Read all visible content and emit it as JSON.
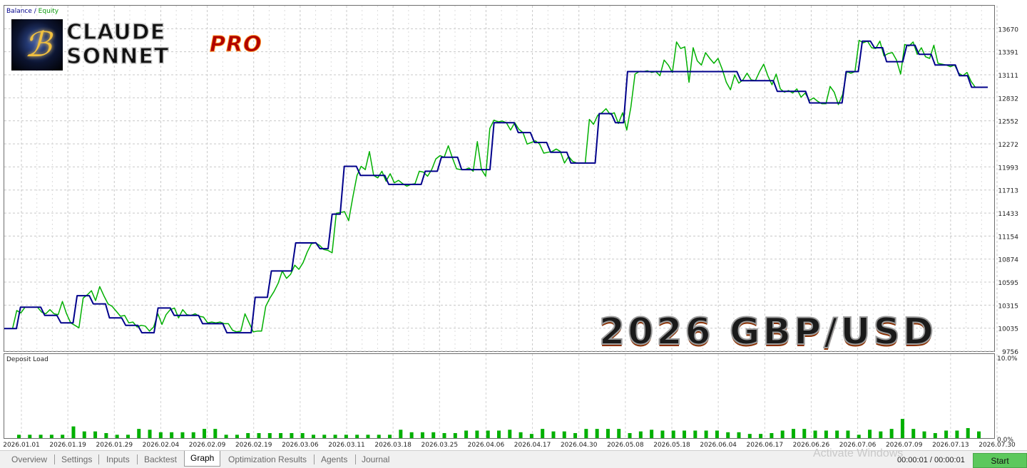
{
  "chart_data": [
    {
      "type": "line",
      "legend": [
        "Balance",
        "Equity"
      ],
      "legend_placement": "top-left",
      "colors": {
        "balance": "#00008b",
        "equity": "#00b000"
      },
      "grid": true,
      "ylim": [
        9756,
        13950
      ],
      "y_ticks": [
        "13670",
        "13391",
        "13111",
        "12832",
        "12552",
        "12272",
        "11993",
        "11713",
        "11433",
        "11154",
        "10874",
        "10595",
        "10315",
        "10035",
        "9756"
      ],
      "x_ticks": [
        "2026.01.01",
        "2026.01.19",
        "2026.01.29",
        "2026.02.04",
        "2026.02.09",
        "2026.02.19",
        "2026.03.06",
        "2026.03.11",
        "2026.03.18",
        "2026.03.25",
        "2026.04.06",
        "2026.04.17",
        "2026.04.30",
        "2026.05.08",
        "2026.05.18",
        "2026.06.04",
        "2026.06.17",
        "2026.06.26",
        "2026.07.06",
        "2026.07.09",
        "2026.07.13",
        "2026.07.30"
      ],
      "series": [
        {
          "name": "Balance",
          "values": [
            10030,
            10030,
            10030,
            10030,
            10290,
            10290,
            10290,
            10290,
            10290,
            10290,
            10190,
            10190,
            10190,
            10190,
            10100,
            10100,
            10100,
            10100,
            10430,
            10430,
            10430,
            10430,
            10330,
            10330,
            10330,
            10330,
            10160,
            10160,
            10160,
            10160,
            10070,
            10070,
            10070,
            10070,
            9980,
            9980,
            9980,
            9980,
            10280,
            10280,
            10280,
            10280,
            10190,
            10190,
            10190,
            10190,
            10190,
            10190,
            10190,
            10090,
            10090,
            10090,
            10090,
            10090,
            10090,
            9980,
            9980,
            9980,
            9980,
            9980,
            9980,
            9980,
            10410,
            10410,
            10410,
            10410,
            10730,
            10730,
            10730,
            10730,
            10730,
            10730,
            11070,
            11070,
            11070,
            11070,
            11070,
            11070,
            11000,
            11000,
            11000,
            11420,
            11420,
            11420,
            12000,
            12000,
            12000,
            12000,
            11890,
            11890,
            11890,
            11890,
            11890,
            11890,
            11890,
            11780,
            11780,
            11780,
            11780,
            11780,
            11780,
            11780,
            11780,
            11780,
            11940,
            11940,
            11940,
            11940,
            12110,
            12110,
            12110,
            12110,
            12110,
            11960,
            11960,
            11960,
            11960,
            11960,
            11960,
            11960,
            11960,
            12530,
            12530,
            12530,
            12530,
            12530,
            12530,
            12410,
            12410,
            12410,
            12410,
            12290,
            12290,
            12290,
            12290,
            12170,
            12170,
            12170,
            12170,
            12170,
            12040,
            12040,
            12040,
            12040,
            12040,
            12040,
            12040,
            12640,
            12640,
            12640,
            12640,
            12530,
            12530,
            12530,
            13150,
            13150,
            13150,
            13150,
            13150,
            13150,
            13150,
            13150,
            13150,
            13150,
            13150,
            13150,
            13150,
            13150,
            13150,
            13150,
            13150,
            13150,
            13150,
            13150,
            13150,
            13150,
            13150,
            13150,
            13150,
            13150,
            13150,
            13150,
            13040,
            13040,
            13040,
            13040,
            13040,
            13040,
            13040,
            13040,
            13040,
            12910,
            12910,
            12910,
            12910,
            12910,
            12910,
            12910,
            12910,
            12770,
            12770,
            12770,
            12770,
            12770,
            12770,
            12770,
            12770,
            12770,
            13150,
            13150,
            13150,
            13150,
            13520,
            13520,
            13520,
            13440,
            13440,
            13440,
            13270,
            13270,
            13270,
            13270,
            13270,
            13470,
            13470,
            13470,
            13360,
            13360,
            13360,
            13360,
            13230,
            13230,
            13230,
            13230,
            13230,
            13230,
            13100,
            13100,
            13100,
            12960,
            12960,
            12960,
            12960,
            12960
          ]
        },
        {
          "name": "Equity",
          "values": [
            10030,
            10030,
            10030,
            10250,
            10220,
            10290,
            10290,
            10290,
            10290,
            10230,
            10210,
            10260,
            10210,
            10200,
            10360,
            10210,
            10100,
            10070,
            10040,
            10400,
            10440,
            10490,
            10370,
            10540,
            10430,
            10330,
            10300,
            10240,
            10180,
            10190,
            10100,
            10110,
            10050,
            10070,
            10060,
            10000,
            10050,
            10210,
            10080,
            10200,
            10260,
            10280,
            10160,
            10260,
            10200,
            10190,
            10210,
            10180,
            10170,
            10100,
            10110,
            10100,
            10110,
            10090,
            10090,
            10010,
            9990,
            10000,
            10210,
            10100,
            9990,
            10000,
            10000,
            10300,
            10400,
            10480,
            10580,
            10730,
            10640,
            10690,
            10800,
            10750,
            10830,
            10960,
            11060,
            11070,
            11040,
            10990,
            10980,
            10950,
            11430,
            11440,
            11450,
            11340,
            11630,
            11890,
            12000,
            11960,
            12180,
            11890,
            11860,
            11940,
            11820,
            11910,
            11800,
            11830,
            11790,
            11760,
            11780,
            11790,
            11940,
            11930,
            11880,
            11960,
            12090,
            12130,
            12110,
            12250,
            12100,
            11970,
            11960,
            11960,
            11980,
            11940,
            12300,
            11960,
            11880,
            12460,
            12560,
            12540,
            12550,
            12530,
            12440,
            12530,
            12450,
            12410,
            12270,
            12290,
            12310,
            12270,
            12160,
            12170,
            12180,
            12210,
            12180,
            12040,
            12120,
            12060,
            12040,
            12040,
            12040,
            12570,
            12510,
            12620,
            12650,
            12700,
            12630,
            12650,
            12520,
            12650,
            12440,
            12720,
            13120,
            13150,
            13150,
            13160,
            13140,
            13150,
            13100,
            13290,
            13230,
            13140,
            13510,
            13430,
            13450,
            13020,
            13440,
            13280,
            13230,
            13380,
            13310,
            13250,
            13310,
            13180,
            13020,
            12930,
            13110,
            13010,
            13050,
            13130,
            13050,
            13040,
            13150,
            13240,
            13100,
            12990,
            13120,
            12940,
            12900,
            12920,
            12890,
            12940,
            12840,
            12890,
            12800,
            12830,
            12790,
            12760,
            12760,
            12970,
            12900,
            12750,
            12870,
            13150,
            13130,
            13150,
            13530,
            13500,
            13520,
            13440,
            13430,
            13520,
            13340,
            13370,
            13380,
            13290,
            13120,
            13480,
            13460,
            13510,
            13360,
            13440,
            13330,
            13310,
            13470,
            13250,
            13240,
            13230,
            13210,
            13230,
            13130,
            13100,
            13140,
            13030,
            12960,
            12960,
            12960,
            12960
          ]
        }
      ]
    },
    {
      "type": "bar",
      "title": "Deposit Load",
      "ylim": [
        0,
        10
      ],
      "y_ticks": [
        "10.0%",
        "0.0%"
      ],
      "color": "#00b000",
      "values": [
        0.4,
        0.4,
        0.4,
        0.4,
        0.4,
        1.4,
        0.8,
        0.8,
        0.6,
        0.4,
        0.4,
        1.1,
        1.0,
        0.7,
        0.7,
        0.7,
        0.7,
        1.1,
        1.1,
        0.4,
        0.4,
        0.6,
        0.6,
        0.6,
        0.6,
        0.6,
        0.6,
        0.4,
        0.4,
        0.4,
        0.4,
        0.4,
        0.4,
        0.4,
        0.4,
        1.0,
        0.7,
        0.7,
        0.7,
        0.6,
        0.6,
        0.9,
        0.9,
        0.9,
        0.9,
        1.0,
        0.7,
        0.5,
        1.1,
        0.8,
        0.8,
        0.6,
        1.1,
        1.1,
        1.1,
        1.1,
        0.6,
        0.8,
        1.0,
        0.9,
        0.9,
        0.9,
        0.9,
        0.9,
        0.9,
        0.7,
        0.7,
        0.5,
        0.5,
        0.6,
        0.9,
        1.1,
        1.1,
        0.9,
        0.9,
        0.9,
        0.9,
        0.4,
        1.0,
        0.8,
        1.1,
        2.3,
        1.1,
        0.8,
        0.6,
        0.9,
        0.9,
        1.2,
        0.8
      ]
    }
  ],
  "overlays": {
    "legend_balance": "Balance",
    "legend_sep": " / ",
    "legend_equity": "Equity",
    "deposit_title": "Deposit Load",
    "brand_line1": "CLAUDE",
    "brand_line2": "SONNET",
    "brand_pro": "PRO",
    "big_title": "2026 GBP/USD"
  },
  "tabs": [
    "Overview",
    "Settings",
    "Inputs",
    "Backtest",
    "Graph",
    "Optimization Results",
    "Agents",
    "Journal"
  ],
  "active_tab": "Graph",
  "timer": "00:00:01 / 00:00:01",
  "start_button": "Start",
  "watermark": "Activate Windows"
}
